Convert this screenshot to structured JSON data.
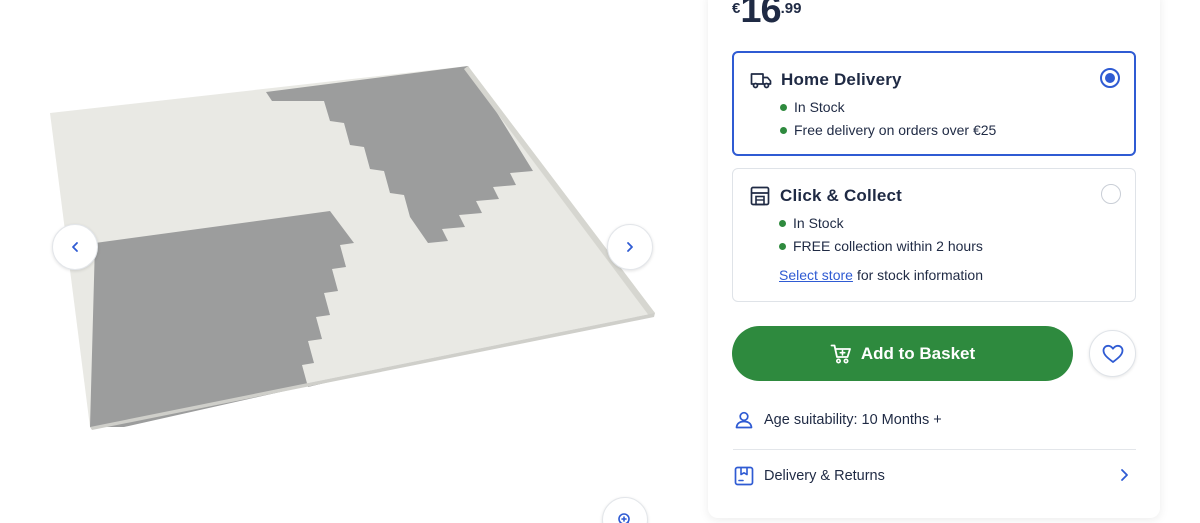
{
  "price": {
    "currency": "€",
    "integer": "16",
    "decimal": ".99"
  },
  "delivery_options": {
    "home": {
      "title": "Home Delivery",
      "selected": true,
      "stock": "In Stock",
      "note": "Free delivery on orders over €25"
    },
    "collect": {
      "title": "Click & Collect",
      "selected": false,
      "stock": "In Stock",
      "note": "FREE collection within 2 hours",
      "select_store_link": "Select store",
      "select_store_suffix": "for stock information"
    }
  },
  "actions": {
    "add_to_basket": "Add to Basket"
  },
  "details": {
    "age": "Age suitability: 10 Months +",
    "delivery_returns": "Delivery & Returns"
  },
  "icons": {
    "truck": "truck-icon",
    "store": "store-icon",
    "cart": "cart-icon",
    "heart": "heart-icon",
    "person": "person-icon",
    "box": "box-icon",
    "chevron_left": "chevron-left-icon",
    "chevron_right": "chevron-right-icon",
    "zoom": "zoom-icon"
  },
  "colors": {
    "accent_blue": "#2f5bd3",
    "cta_green": "#2e8a3e",
    "text": "#1f2a44",
    "mat_light": "#ebebe6",
    "mat_grey": "#9a9b9b"
  }
}
